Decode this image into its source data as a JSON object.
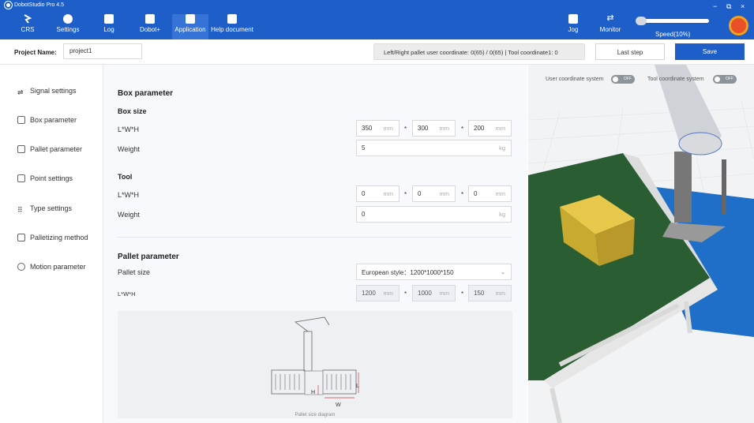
{
  "app": {
    "title": "DobotStudio Pro 4.5"
  },
  "nav": {
    "crs": "CRS",
    "settings": "Settings",
    "log": "Log",
    "dobotplus": "Dobot+",
    "application": "Application",
    "help": "Help document",
    "jog": "Jog",
    "monitor": "Monitor",
    "speed": "Speed(10%)"
  },
  "speed": {
    "percent": 10
  },
  "window": {
    "minimize": "−",
    "restore": "⧉",
    "close": "×"
  },
  "project": {
    "label": "Project Name:",
    "name": "project1"
  },
  "coord_info": "Left/Right pallet user coordinate: 0(65) / 0(65) | Tool coordinate1: 0",
  "buttons": {
    "last_step": "Last step",
    "save": "Save"
  },
  "sidebar": {
    "items": [
      {
        "label": "Signal settings"
      },
      {
        "label": "Box parameter"
      },
      {
        "label": "Pallet parameter"
      },
      {
        "label": "Point settings"
      },
      {
        "label": "Type settings"
      },
      {
        "label": "Palletizing method"
      },
      {
        "label": "Motion parameter"
      }
    ]
  },
  "box": {
    "section_title": "Box parameter",
    "size_title": "Box size",
    "lwh_label": "L*W*H",
    "l": "350",
    "w": "300",
    "h": "200",
    "weight_label": "Weight",
    "weight": "5"
  },
  "tool": {
    "title": "Tool",
    "lwh_label": "L*W*H",
    "l": "0",
    "w": "0",
    "h": "0",
    "weight_label": "Weight",
    "weight": "0"
  },
  "units": {
    "mm": "mm",
    "kg": "kg"
  },
  "sep": "*",
  "pallet": {
    "title": "Pallet parameter",
    "size_label": "Pallet size",
    "size_value": "European style：1200*1000*150",
    "lwh_label": "L*W*H",
    "l": "1200",
    "w": "1000",
    "h": "150",
    "diagram_caption": "Pallet size diagram",
    "dim_h": "H",
    "dim_w": "W",
    "dim_l": "L"
  },
  "scene": {
    "user_coord_label": "User coordinate system",
    "tool_coord_label": "Tool coordinate system",
    "off": "OFF"
  }
}
